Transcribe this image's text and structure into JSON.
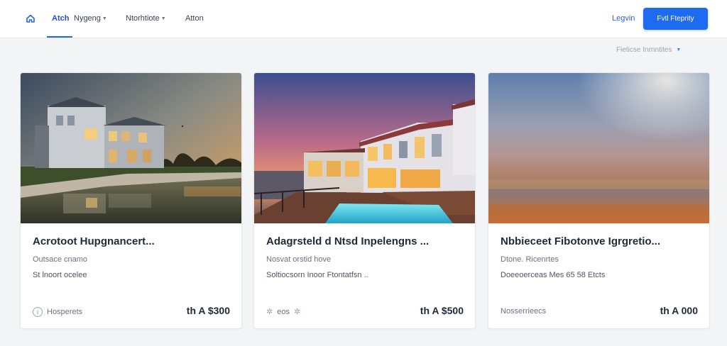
{
  "header": {
    "nav": [
      {
        "label": "Atch",
        "active": true
      },
      {
        "label": "Nygeng",
        "dropdown": true
      },
      {
        "label": "Ntorhtiote",
        "dropdown": true
      },
      {
        "label": "Atton"
      }
    ],
    "login_label": "Legvin",
    "cta_label": "Fvtl Fteprity",
    "logo_icon": "home-icon"
  },
  "toolbar": {
    "sort_label": "Fieticse Inrnntites"
  },
  "cards": [
    {
      "title": "Acrotoot Hupgnancert...",
      "line1": "Outsace cnamo",
      "line2": "St lnoort ocelee",
      "meta": "Hosperets",
      "meta_icon": "info-icon",
      "price": "th A $300"
    },
    {
      "title": "Adagrsteld d Ntsd  Inpelengns ...",
      "line1": "Nosvat orstid hove",
      "line2": "Soltiocsorn Inoor Ftontatfsn  ..",
      "meta": "eos",
      "meta_icon": "star-icon",
      "price": "th A $500"
    },
    {
      "title": "Nbbieceet Fibotonve Igrgretio...",
      "line1": "Dtone. Ricenrtes",
      "line2": "Doeeoerceas Mes 65 58 Etcts",
      "meta": "Nosserrieecs",
      "meta_icon": "",
      "price": "th A 000"
    }
  ],
  "colors": {
    "accent": "#1e6bf0",
    "link": "#2563eb",
    "background": "#f3f4f6"
  }
}
